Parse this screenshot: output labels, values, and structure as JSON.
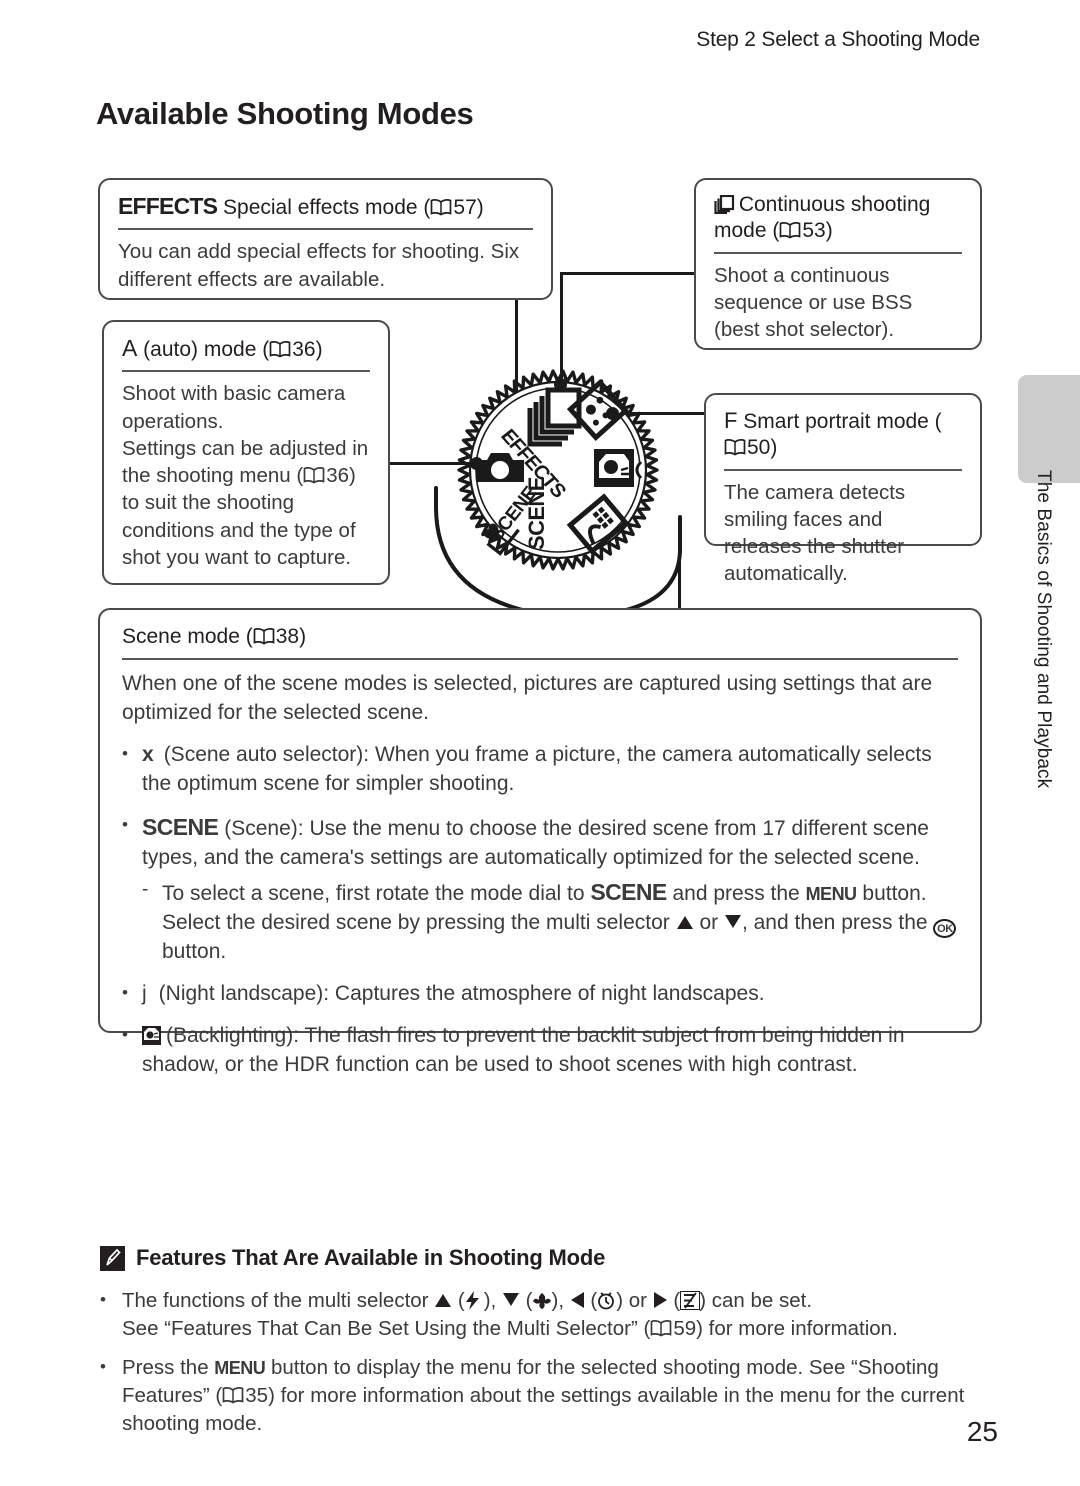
{
  "header": {
    "running_head": "Step 2 Select a Shooting Mode",
    "title": "Available Shooting Modes"
  },
  "side_tab": {
    "label": "The Basics of Shooting and Playback",
    "color": "#cccccc"
  },
  "callouts": {
    "effects": {
      "icon_label": "EFFECTS",
      "heading_rest": " Special effects mode (",
      "page_ref": "57",
      "heading_close": ")",
      "body": "You can add special effects for shooting. Six different effects are available."
    },
    "auto": {
      "icon_label": "A",
      "heading_rest": "  (auto) mode (",
      "page_ref": "36",
      "heading_close": ")",
      "body_line1": "Shoot with basic camera operations.",
      "body_line2a": "Settings can be adjusted in the shooting menu (",
      "body_ref": "36",
      "body_line2b": ") to suit the shooting conditions and the type of shot you want to capture."
    },
    "continuous": {
      "icon_name": "continuous-shooting-icon",
      "heading_rest": " Continuous shooting mode (",
      "page_ref": "53",
      "heading_close": ")",
      "body": "Shoot a continuous sequence or use BSS (best shot selector)."
    },
    "portrait": {
      "icon_label": "F",
      "heading_rest": "  Smart portrait mode (",
      "page_ref": "50",
      "heading_close": ")",
      "body": "The camera detects smiling faces and releases the shutter automatically."
    },
    "scene": {
      "heading_main": "Scene mode (",
      "page_ref": "38",
      "heading_close": ")",
      "intro": "When one of the scene modes is selected, pictures are captured using settings that are optimized for the selected scene.",
      "bullets": [
        {
          "symbol": "x",
          "symbol_name": "scene-auto-selector-icon",
          "text": "(Scene auto selector): When you frame a picture, the camera automatically selects the optimum scene for simpler shooting."
        },
        {
          "symbol": "SCENE",
          "symbol_name": "scene-icon",
          "text_a": "(Scene): Use the menu to choose the desired scene from 17 different scene types, and the camera's settings are automatically optimized for the selected scene.",
          "sub": {
            "dash": "-",
            "text_a": "To select a scene, first rotate the mode dial to ",
            "scene_word": "SCENE",
            "text_b": " and press the ",
            "menu_word": "MENU",
            "text_c": " button. Select the desired scene by pressing the multi selector ",
            "text_d": " or ",
            "text_e": ", and then press the ",
            "ok_word": "OK",
            "text_f": " button."
          }
        },
        {
          "symbol": "j",
          "symbol_name": "night-landscape-icon",
          "text": "(Night landscape): Captures the atmosphere of night landscapes."
        },
        {
          "symbol": "",
          "symbol_name": "backlighting-icon",
          "text": "(Backlighting): The flash fires to prevent the backlit subject from being hidden in shadow, or the HDR function can be used to shoot scenes with high contrast."
        }
      ]
    }
  },
  "mode_dial": {
    "name": "mode-dial-illustration",
    "positions": [
      {
        "id": "effects",
        "label": "EFFECTS"
      },
      {
        "id": "continuous",
        "label": "continuous-shooting"
      },
      {
        "id": "smart-portrait",
        "label": "smart-portrait"
      },
      {
        "id": "night-landscape",
        "label": "night-landscape"
      },
      {
        "id": "backlighting",
        "label": "backlighting"
      },
      {
        "id": "scene",
        "label": "SCENE"
      },
      {
        "id": "scene-auto",
        "label": "SCENE-auto"
      },
      {
        "id": "auto",
        "label": "auto-camera"
      }
    ]
  },
  "note": {
    "icon_name": "pencil-note-icon",
    "title": "Features That Are Available in Shooting Mode",
    "bullets": [
      {
        "text_a": "The functions of the multi selector ",
        "text_b": " (",
        "flash": "flash-icon",
        "text_c": "), ",
        "macro": "macro-icon",
        "text_d": "), ",
        "timer": "self-timer-icon",
        "text_e": ") or ",
        "evcomp": "exposure-compensation-icon",
        "text_f": ") can be set.",
        "line2_a": "See “Features That Can Be Set Using the Multi Selector” (",
        "line2_ref": "59",
        "line2_b": ") for more information."
      },
      {
        "text_a": "Press the ",
        "menu_word": "MENU",
        "text_b": " button to display the menu for the selected shooting mode. See “Shooting Features” (",
        "ref": "35",
        "text_c": ") for more information about the settings available in the menu for the current shooting mode."
      }
    ]
  },
  "page_number": "25"
}
